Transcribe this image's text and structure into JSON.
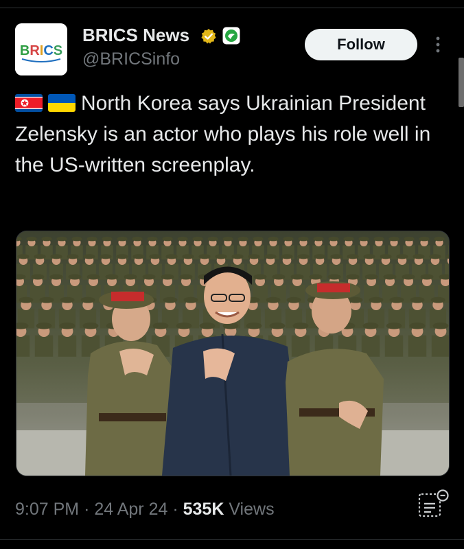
{
  "author": {
    "name": "BRICS News",
    "handle": "@BRICSinfo",
    "avatar_logo_text": "BRICS",
    "badges": [
      "verified-checkmark-icon",
      "affiliate-badge-icon"
    ]
  },
  "follow_button": {
    "label": "Follow"
  },
  "more_menu": {
    "icon": "more-vertical-icon"
  },
  "tweet": {
    "flags": [
      "flag-north-korea",
      "flag-ukraine"
    ],
    "text": "North Korea says Ukrainian President Zelensky is an actor who plays his role well in the US-written screenplay."
  },
  "media": {
    "type": "photo",
    "alt": ""
  },
  "meta": {
    "time": "9:07 PM",
    "separator": "·",
    "date": "24 Apr 24",
    "views_count": "535K",
    "views_label": "Views"
  },
  "colors": {
    "background": "#000000",
    "primary_text": "#e7e9ea",
    "secondary_text": "#71767b",
    "follow_button_bg": "#eff3f4",
    "verified_gold": "#e2b719",
    "affiliate_green": "#26a641"
  }
}
